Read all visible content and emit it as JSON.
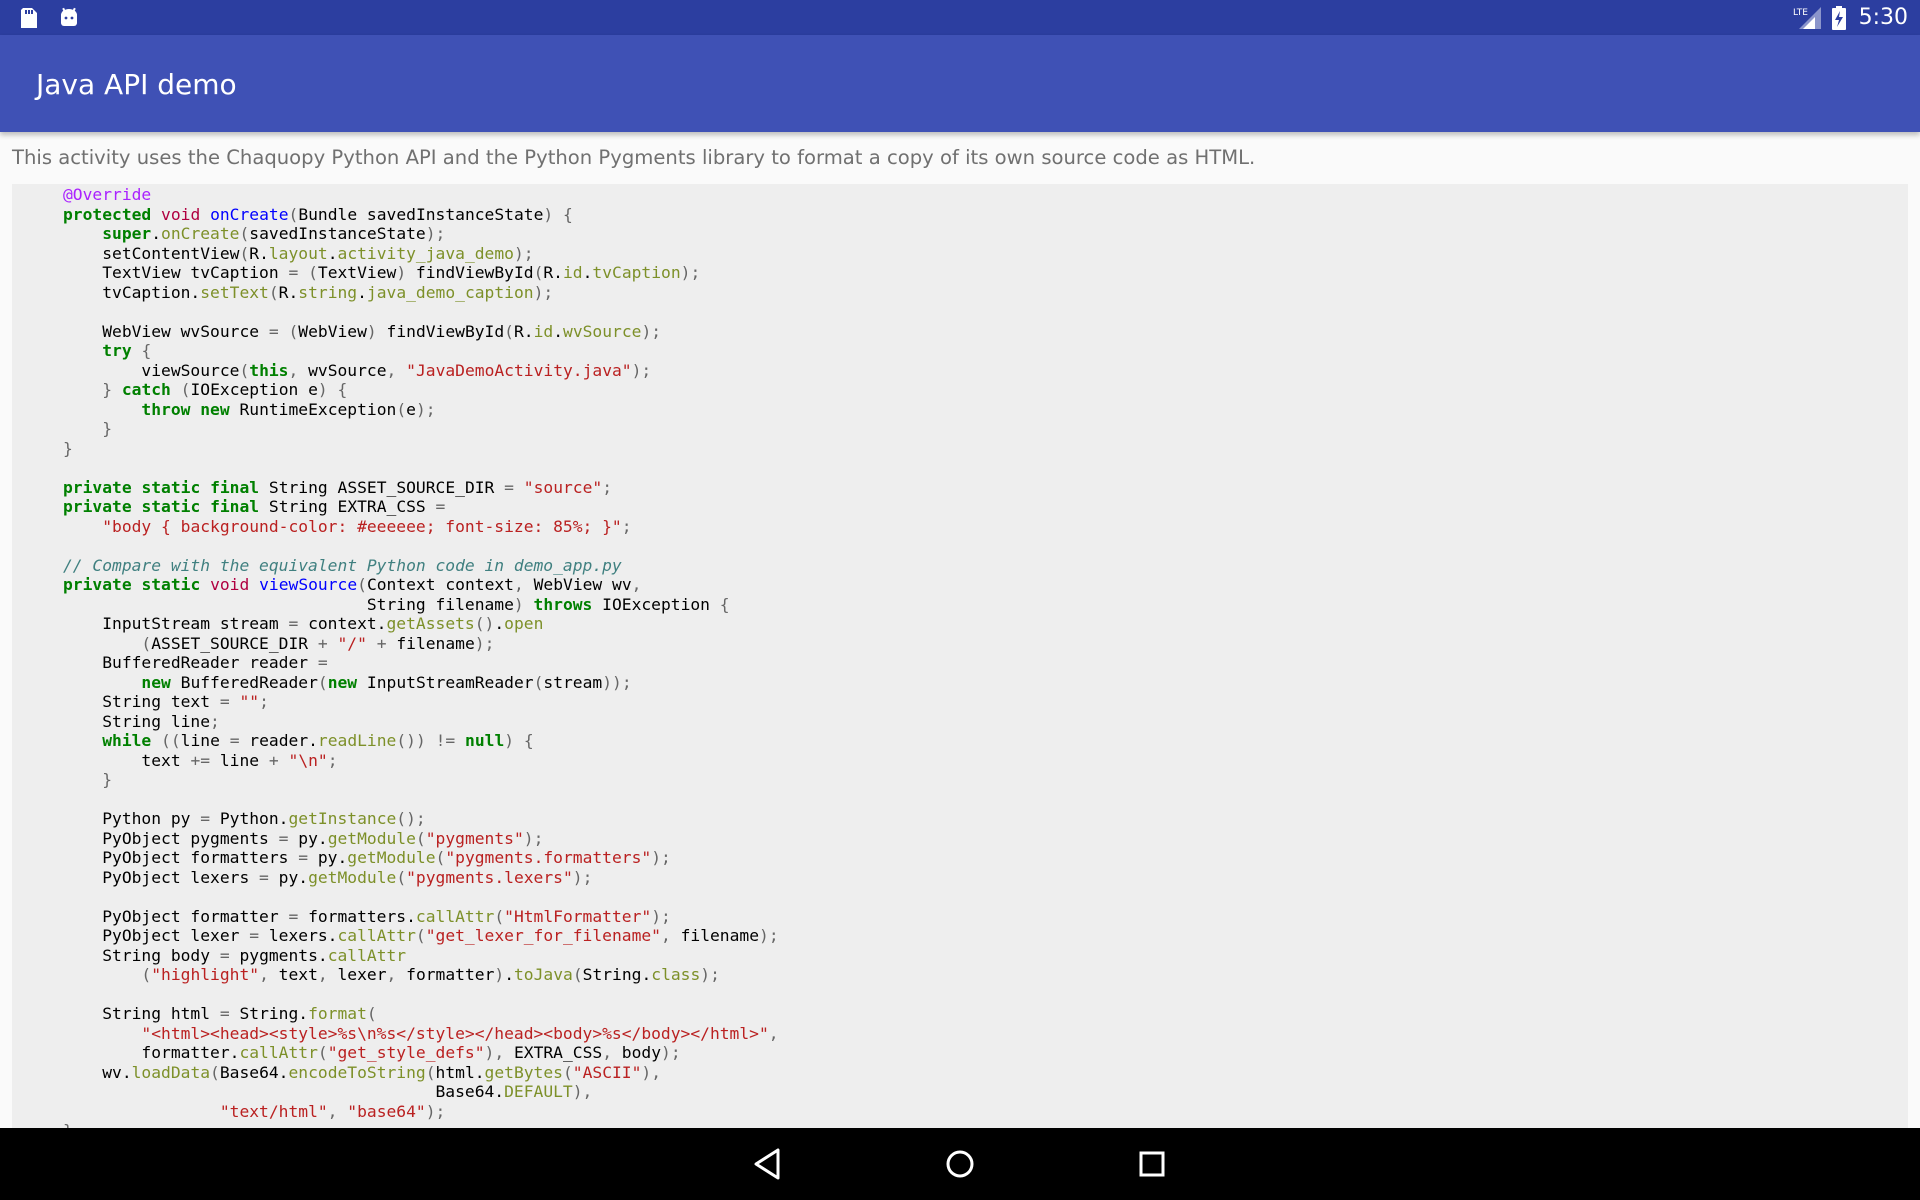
{
  "status_bar": {
    "left_icons": [
      "sd-card-icon",
      "android-debug-icon"
    ],
    "network": "LTE",
    "time": "5:30"
  },
  "app_bar": {
    "title": "Java API demo"
  },
  "caption": "This activity uses the Chaquopy Python API and the Python Pygments library to format a copy of its own source code as HTML.",
  "source": {
    "file": "JavaDemoActivity.java",
    "lines": [
      "@Override",
      "protected void onCreate(Bundle savedInstanceState) {",
      "    super.onCreate(savedInstanceState);",
      "    setContentView(R.layout.activity_java_demo);",
      "    TextView tvCaption = (TextView) findViewById(R.id.tvCaption);",
      "    tvCaption.setText(R.string.java_demo_caption);",
      "",
      "    WebView wvSource = (WebView) findViewById(R.id.wvSource);",
      "    try {",
      "        viewSource(this, wvSource, \"JavaDemoActivity.java\");",
      "    } catch (IOException e) {",
      "        throw new RuntimeException(e);",
      "    }",
      "}",
      "",
      "private static final String ASSET_SOURCE_DIR = \"source\";",
      "private static final String EXTRA_CSS =",
      "    \"body { background-color: #eeeeee; font-size: 85%; }\";",
      "",
      "// Compare with the equivalent Python code in demo_app.py",
      "private static void viewSource(Context context, WebView wv,",
      "                               String filename) throws IOException {",
      "    InputStream stream = context.getAssets().open",
      "        (ASSET_SOURCE_DIR + \"/\" + filename);",
      "    BufferedReader reader =",
      "        new BufferedReader(new InputStreamReader(stream));",
      "    String text = \"\";",
      "    String line;",
      "    while ((line = reader.readLine()) != null) {",
      "        text += line + \"\\n\";",
      "    }",
      "",
      "    Python py = Python.getInstance();",
      "    PyObject pygments = py.getModule(\"pygments\");",
      "    PyObject formatters = py.getModule(\"pygments.formatters\");",
      "    PyObject lexers = py.getModule(\"pygments.lexers\");",
      "",
      "    PyObject formatter = formatters.callAttr(\"HtmlFormatter\");",
      "    PyObject lexer = lexers.callAttr(\"get_lexer_for_filename\", filename);",
      "    String body = pygments.callAttr",
      "        (\"highlight\", text, lexer, formatter).toJava(String.class);",
      "",
      "    String html = String.format(",
      "        \"<html><head><style>%s\\n%s</style></head><body>%s</body></html>\",",
      "        formatter.callAttr(\"get_style_defs\"), EXTRA_CSS, body);",
      "    wv.loadData(Base64.encodeToString(html.getBytes(\"ASCII\"),",
      "                                      Base64.DEFAULT),",
      "                \"text/html\", \"base64\");",
      "}"
    ]
  },
  "nav_bar": {
    "back": "back-icon",
    "home": "home-icon",
    "recents": "recents-icon"
  },
  "colors": {
    "status_bar": "#2c3ea0",
    "app_bar": "#3f51b5",
    "code_background": "#eeeeee",
    "keyword": "#008000",
    "type": "#b00040",
    "function": "#0000ff",
    "string": "#ba2121",
    "comment": "#408080",
    "annotation": "#aa22ff",
    "attribute": "#7d9029"
  }
}
